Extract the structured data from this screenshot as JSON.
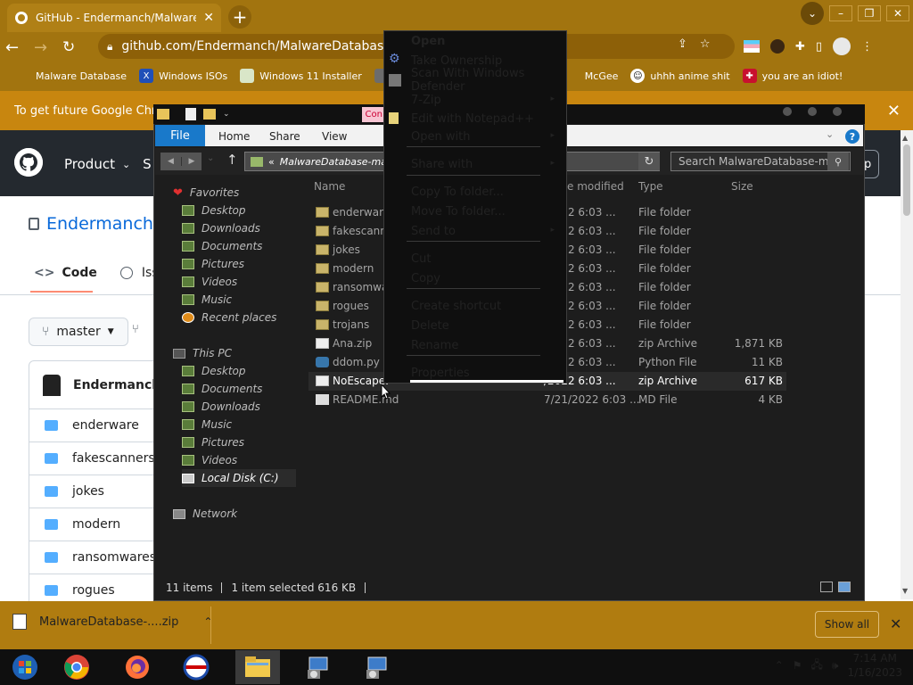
{
  "browser": {
    "tab_title": "GitHub - Endermanch/MalwareDa",
    "url": "github.com/Endermanch/MalwareDatabase",
    "bookmarks": [
      {
        "label": "Malware Database",
        "icon": "bookmark-page-icon"
      },
      {
        "label": "Windows ISOs",
        "icon": "x-logo-icon"
      },
      {
        "label": "Windows 11 Installer",
        "icon": "image-icon"
      },
      {
        "label": "McGee",
        "icon": "bookmark-page-icon"
      },
      {
        "label": "uhhh anime shit",
        "icon": "face-icon"
      },
      {
        "label": "you are an idiot!",
        "icon": "flag-icon"
      }
    ],
    "infobar_text": "To get future Google Chrom",
    "accent": "#a2740f"
  },
  "github": {
    "nav_product": "Product",
    "nav_s": "S",
    "signup_fragment": "up",
    "repo_owner": "Endermanch /",
    "tab_code": "Code",
    "tab_issues": "Issu",
    "branch": "master",
    "owner_row": "Endermanch",
    "files": [
      "enderware",
      "fakescanners",
      "jokes",
      "modern",
      "ransomwares",
      "rogues"
    ]
  },
  "downloads": {
    "file": "MalwareDatabase-....zip",
    "show_all": "Show all"
  },
  "explorer": {
    "tab_fragment": "Con",
    "ribbon": {
      "file": "File",
      "home": "Home",
      "share": "Share",
      "view": "View"
    },
    "address": "MalwareDatabase-mast",
    "address_prefix": "«",
    "search_placeholder": "Search MalwareDatabase-m...",
    "columns": {
      "name": "Name",
      "date": "e modified",
      "type": "Type",
      "size": "Size"
    },
    "sidebar": {
      "favorites": "Favorites",
      "fav_items": [
        "Desktop",
        "Downloads",
        "Documents",
        "Pictures",
        "Videos",
        "Music",
        "Recent places"
      ],
      "thispc": "This PC",
      "pc_items": [
        "Desktop",
        "Documents",
        "Downloads",
        "Music",
        "Pictures",
        "Videos"
      ],
      "local_disk": "Local Disk (C:)",
      "network": "Network"
    },
    "files": [
      {
        "name": "enderware",
        "date": "/2022 6:03 ...",
        "type": "File folder",
        "size": "",
        "kind": "dir"
      },
      {
        "name": "fakescann",
        "date": "/2022 6:03 ...",
        "type": "File folder",
        "size": "",
        "kind": "dir"
      },
      {
        "name": "jokes",
        "date": "/2022 6:03 ...",
        "type": "File folder",
        "size": "",
        "kind": "dir"
      },
      {
        "name": "modern",
        "date": "/2022 6:03 ...",
        "type": "File folder",
        "size": "",
        "kind": "dir"
      },
      {
        "name": "ransomwa",
        "date": "/2022 6:03 ...",
        "type": "File folder",
        "size": "",
        "kind": "dir"
      },
      {
        "name": "rogues",
        "date": "/2022 6:03 ...",
        "type": "File folder",
        "size": "",
        "kind": "dir"
      },
      {
        "name": "trojans",
        "date": "/2022 6:03 ...",
        "type": "File folder",
        "size": "",
        "kind": "dir"
      },
      {
        "name": "Ana.zip",
        "date": "/2022 6:03 ...",
        "type": "zip Archive",
        "size": "1,871 KB",
        "kind": "zip"
      },
      {
        "name": "ddom.py",
        "date": "/2022 6:03 ...",
        "type": "Python File",
        "size": "11 KB",
        "kind": "py"
      },
      {
        "name": "NoEscape.",
        "date": "/2022 6:03 ...",
        "type": "zip Archive",
        "size": "617 KB",
        "kind": "zip"
      },
      {
        "name": "README.md",
        "date": "7/21/2022 6:03 ...",
        "type": "MD File",
        "size": "4 KB",
        "kind": "md"
      }
    ],
    "status": {
      "count": "11 items",
      "selected": "1 item selected  616 KB"
    }
  },
  "context_menu": [
    {
      "label": "Open",
      "bold": true
    },
    {
      "label": "Take Ownership",
      "icon": "gear-icon"
    },
    {
      "label": "Scan With Windows Defender",
      "icon": "defender-icon"
    },
    {
      "label": "7-Zip",
      "submenu": true
    },
    {
      "label": "Edit with Notepad++",
      "icon": "notepad-icon"
    },
    {
      "label": "Open with",
      "submenu": true
    },
    {
      "label": "Share with",
      "submenu": true
    },
    {
      "label": "Copy To folder..."
    },
    {
      "label": "Move To folder..."
    },
    {
      "label": "Send to",
      "submenu": true
    },
    {
      "label": "Cut"
    },
    {
      "label": "Copy"
    },
    {
      "label": "Create shortcut"
    },
    {
      "label": "Delete"
    },
    {
      "label": "Rename"
    },
    {
      "label": "Properties"
    }
  ],
  "taskbar": {
    "time": "7:14 AM",
    "date": "1/16/2023"
  }
}
